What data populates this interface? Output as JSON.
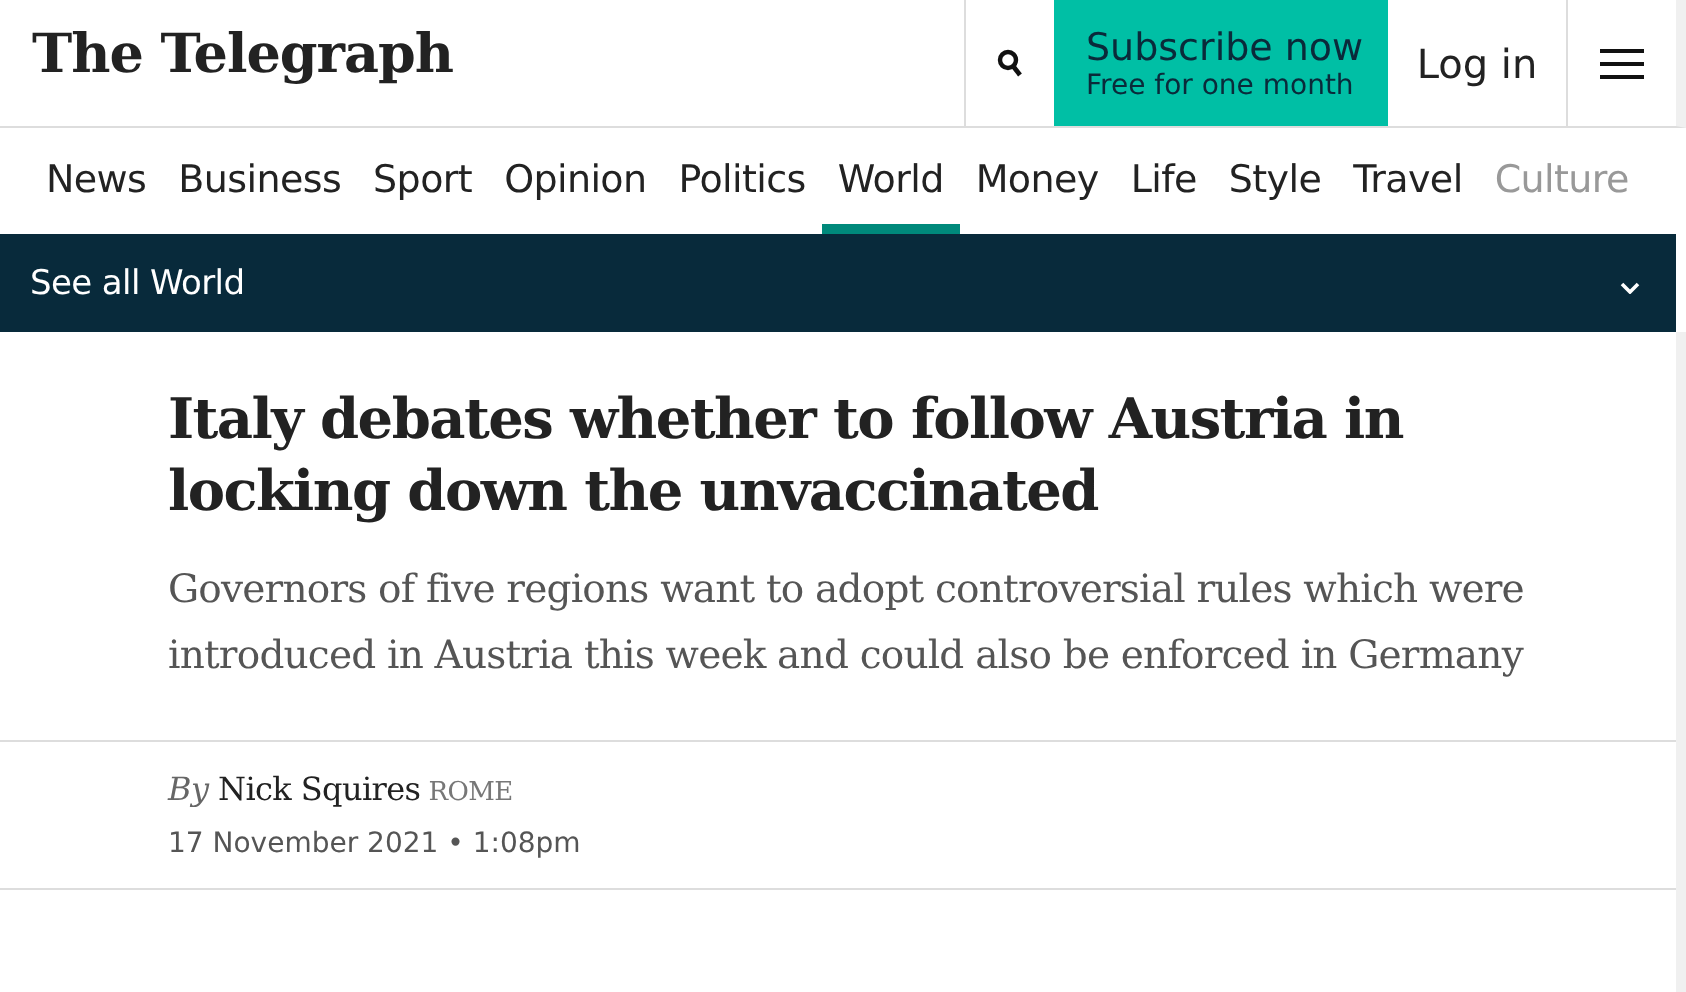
{
  "header": {
    "logo": "The Telegraph",
    "subscribe": {
      "title": "Subscribe now",
      "subtitle": "Free for one month"
    },
    "login": "Log in"
  },
  "nav": [
    {
      "label": "News",
      "selected": false
    },
    {
      "label": "Business",
      "selected": false
    },
    {
      "label": "Sport",
      "selected": false
    },
    {
      "label": "Opinion",
      "selected": false
    },
    {
      "label": "Politics",
      "selected": false
    },
    {
      "label": "World",
      "selected": true
    },
    {
      "label": "Money",
      "selected": false
    },
    {
      "label": "Life",
      "selected": false
    },
    {
      "label": "Style",
      "selected": false
    },
    {
      "label": "Travel",
      "selected": false
    },
    {
      "label": "Culture",
      "selected": false
    }
  ],
  "section_bar": {
    "label": "See all World",
    "expanded": false
  },
  "article": {
    "headline": "Italy debates whether to follow Austria in locking down the unvaccinated",
    "standfirst": "Governors of five regions want to adopt controversial rules which were introduced in Austria this week and could also be enforced in Germany",
    "byline": {
      "prefix": "By",
      "author": "Nick Squires",
      "location": "ROME"
    },
    "date": "17 November 2021 • 1:08pm"
  }
}
